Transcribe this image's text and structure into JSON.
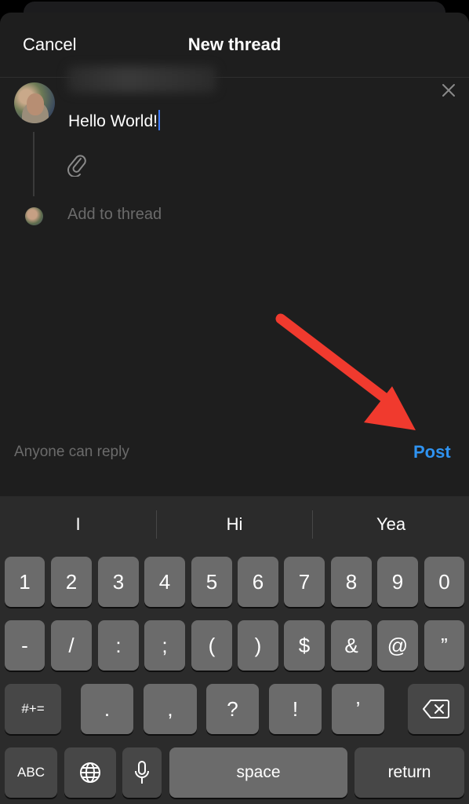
{
  "header": {
    "cancel_label": "Cancel",
    "title": "New thread"
  },
  "composer": {
    "text": "Hello World!"
  },
  "add_to_thread_placeholder": "Add to thread",
  "footer": {
    "reply_setting": "Anyone can reply",
    "post_label": "Post"
  },
  "colors": {
    "accent": "#2f93f1",
    "arrow": "#f03a2e",
    "sheet": "#1e1e1e"
  },
  "icons": {
    "close": "close-icon",
    "attach": "paperclip-icon",
    "delete": "delete-backspace-icon",
    "globe": "globe-icon",
    "mic": "microphone-icon"
  },
  "keyboard": {
    "suggestions": [
      "I",
      "Hi",
      "Yea"
    ],
    "row1": [
      "1",
      "2",
      "3",
      "4",
      "5",
      "6",
      "7",
      "8",
      "9",
      "0"
    ],
    "row2": [
      "-",
      "/",
      ":",
      ";",
      "(",
      ")",
      "$",
      "&",
      "@",
      "”"
    ],
    "row3": [
      "#+=",
      ".",
      ",",
      "?",
      "!",
      "’"
    ],
    "abc": "ABC",
    "space": "space",
    "return": "return"
  }
}
